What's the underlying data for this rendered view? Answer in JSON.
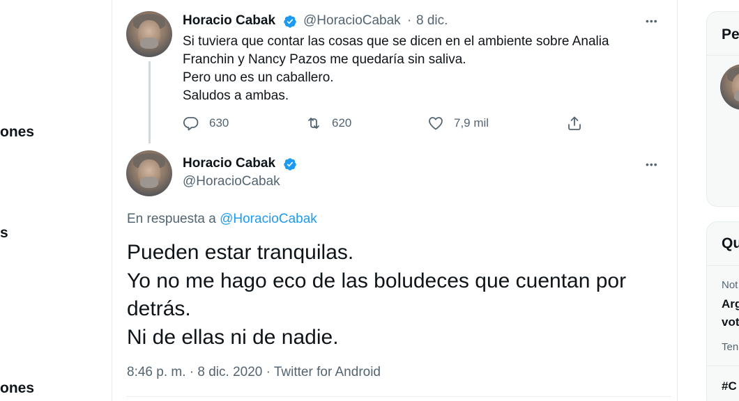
{
  "left_nav": {
    "items": [
      {
        "label": "ones"
      },
      {
        "label": "s"
      },
      {
        "label": "ones"
      }
    ]
  },
  "tweet1": {
    "author_name": "Horacio Cabak",
    "handle": "@HoracioCabak",
    "separator": "·",
    "date": "8 dic.",
    "more": "•••",
    "lines": [
      "Si tuviera que contar las cosas que se dicen en el ambiente sobre Analia",
      "Franchin y  Nancy Pazos me quedaría sin saliva.",
      "Pero uno es un caballero.",
      "Saludos a ambas."
    ],
    "replies": "630",
    "retweets": "620",
    "likes": "7,9 mil"
  },
  "tweet2": {
    "author_name": "Horacio Cabak",
    "handle": "@HoracioCabak",
    "more": "•••",
    "reply_prefix": "En respuesta a",
    "reply_to": "@HoracioCabak",
    "lines": [
      "Pueden estar tranquilas.",
      "Yo no me hago eco de las boludeces que cuentan por",
      "detrás.",
      "Ni de ellas ni de nadie."
    ],
    "timestamp": "8:46 p. m. · 8 dic. 2020 · Twitter for Android"
  },
  "sidebar": {
    "card1_title": "Pe",
    "card2_title": "Qu",
    "trend_category": "Not",
    "trend_title_line1": "Arg",
    "trend_title_line2": "vot",
    "trend_meta": "Ten",
    "hashtag": "#C"
  },
  "colors": {
    "accent": "#1d9bf0",
    "secondary_text": "#536471",
    "border": "#e6ecf0"
  },
  "icons": {
    "reply": "reply-icon",
    "retweet": "retweet-icon",
    "like": "heart-icon",
    "share": "share-icon",
    "verified": "verified-badge-icon",
    "more": "more-icon"
  }
}
